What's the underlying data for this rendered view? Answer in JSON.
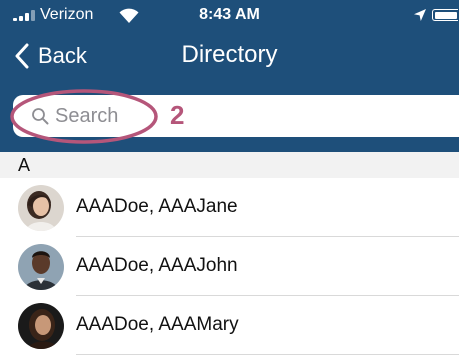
{
  "status_bar": {
    "carrier": "Verizon",
    "time": "8:43 AM",
    "signal_icon": "signal-bars-icon",
    "wifi_icon": "wifi-icon",
    "location_icon": "location-arrow-icon",
    "battery_icon": "battery-icon",
    "battery_level": 1.0
  },
  "nav": {
    "back_label": "Back",
    "title": "Directory"
  },
  "search": {
    "placeholder": "Search",
    "value": ""
  },
  "annotation": {
    "number": "2",
    "color": "#b5567a"
  },
  "colors": {
    "header_background": "#1e4f7a",
    "section_background": "#f2f2f2"
  },
  "directory": {
    "section_letter": "A",
    "contacts": [
      {
        "name": "AAADoe, AAAJane"
      },
      {
        "name": "AAADoe, AAAJohn"
      },
      {
        "name": "AAADoe, AAAMary"
      }
    ]
  }
}
